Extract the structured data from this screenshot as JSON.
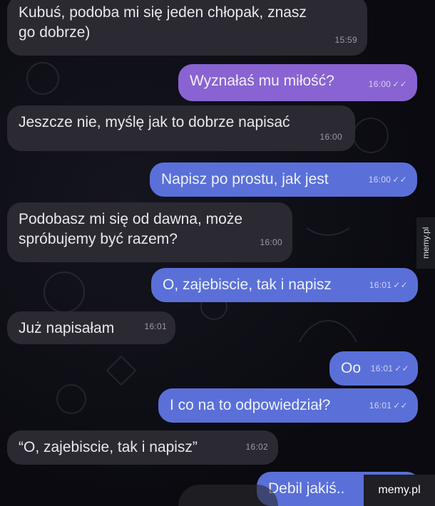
{
  "messages": [
    {
      "text": "Kubuś, podoba mi się jeden chłopak, znasz\ngo dobrze)",
      "time": "15:59",
      "side": "in"
    },
    {
      "text": "Wyznałaś mu miłość?",
      "time": "16:00",
      "side": "out"
    },
    {
      "text": "Jeszcze nie, myślę jak to dobrze napisać",
      "time": "16:00",
      "side": "in"
    },
    {
      "text": "Napisz po prostu, jak jest",
      "time": "16:00",
      "side": "out"
    },
    {
      "text": "Podobasz mi się od dawna, może\nspróbujemy być razem?",
      "time": "16:00",
      "side": "in"
    },
    {
      "text": "O, zajebiscie, tak i napisz",
      "time": "16:01",
      "side": "out"
    },
    {
      "text": "Już napisałam",
      "time": "16:01",
      "side": "in"
    },
    {
      "text": "Oo",
      "time": "16:01",
      "side": "out"
    },
    {
      "text": "I co na to odpowiedział?",
      "time": "16:01",
      "side": "out"
    },
    {
      "text": "“O, zajebiscie, tak i napisz”",
      "time": "16:02",
      "side": "in"
    },
    {
      "text": "Debil jakiś..",
      "time": "",
      "side": "out"
    }
  ],
  "read_ticks": "✓✓",
  "watermark": {
    "side": "memy.pl",
    "corner": "memy.pl"
  },
  "colors": {
    "incoming": "#2b2a33",
    "outgoing_purple": "#8a63d2",
    "outgoing_blue": "#5a70d8",
    "background": "#0b0b12"
  }
}
